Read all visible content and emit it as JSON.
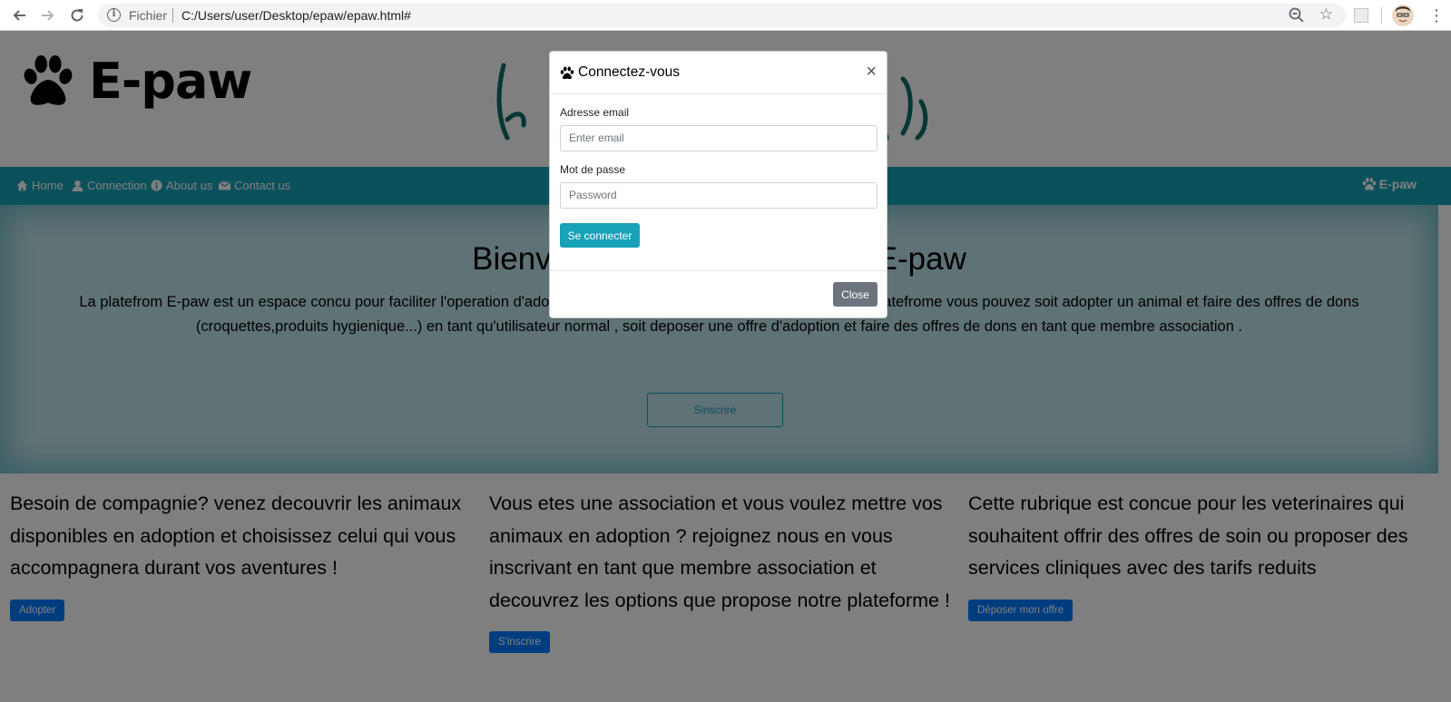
{
  "browser": {
    "scheme_label": "Fichier",
    "url": "C:/Users/user/Desktop/epaw/epaw.html#"
  },
  "header": {
    "logo_text": "E-paw"
  },
  "navbar": {
    "items": [
      {
        "label": "Home",
        "icon": "home-icon"
      },
      {
        "label": "Connection",
        "icon": "user-icon"
      },
      {
        "label": "About us",
        "icon": "info-icon"
      },
      {
        "label": "Contact us",
        "icon": "envelope-icon"
      }
    ],
    "brand": "E-paw"
  },
  "jumbotron": {
    "title": "Bienvenue sur la plateforme E-paw",
    "text": "La platefrom E-paw est un espace concu pour faciliter l'operation d'adoption des animaux de compagnie. Grace a cette platefrome vous pouvez soit adopter un animal et faire des offres de dons (croquettes,produits hygienique...) en tant qu'utilisateur normal , soit deposer une offre d'adoption et faire des offres de dons en tant que membre association .",
    "button": "Sinscrire"
  },
  "columns": [
    {
      "text": "Besoin de compagnie? venez decouvrir les animaux disponibles en adoption et choisissez celui qui vous accompagnera durant vos aventures !",
      "button": "Adopter"
    },
    {
      "text": "Vous etes une association et vous voulez mettre vos animaux en adoption ? rejoignez nous en vous inscrivant en tant que membre association et decouvrez les options que propose notre plateforme !",
      "button": "S'inscrire"
    },
    {
      "text": "Cette rubrique est concue pour les veterinaires qui souhaitent offrir des offres de soin ou proposer des services cliniques avec des tarifs reduits",
      "button": "Déposer mon offre"
    }
  ],
  "modal": {
    "title": "Connectez-vous",
    "close_symbol": "×",
    "email_label": "Adresse email",
    "email_placeholder": "Enter email",
    "password_label": "Mot de passe",
    "password_placeholder": "Password",
    "submit": "Se connecter",
    "close": "Close"
  },
  "colors": {
    "navbar": "#17a2b8",
    "primary": "#007bff",
    "secondary": "#6c757d"
  }
}
